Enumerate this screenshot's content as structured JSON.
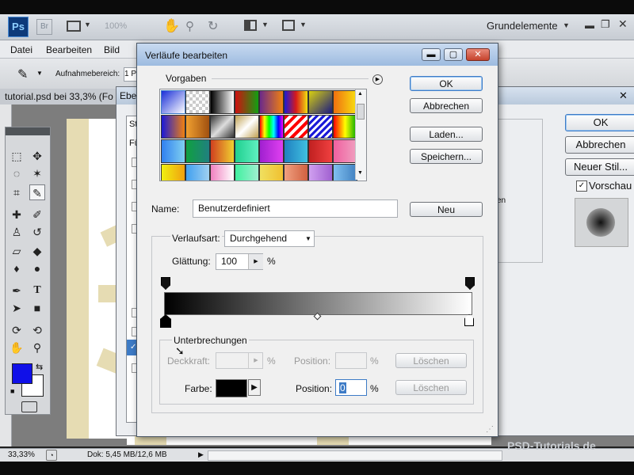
{
  "app": {
    "logo": "Ps",
    "bridge": "Br",
    "zoom_select": "100%",
    "workspace": "Grundelemente",
    "menu": [
      "Datei",
      "Bearbeiten",
      "Bild"
    ],
    "options_label": "Aufnahmebereich:",
    "options_value": "1 P",
    "doc_tab": "tutorial.psd bei 33,3% (Fo",
    "status_zoom": "33,33%",
    "status_doc": "Dok: 5,45 MB/12,6 MB",
    "watermark": "PSD-Tutorials.de"
  },
  "style_dialog": {
    "title_fragment": "Eben",
    "list_items": [
      "St",
      "Fü"
    ],
    "side_text": "en",
    "ok": "OK",
    "cancel": "Abbrechen",
    "new_style": "Neuer Stil...",
    "preview": "Vorschau"
  },
  "dialog": {
    "title": "Verläufe bearbeiten",
    "presets_label": "Vorgaben",
    "buttons": {
      "ok": "OK",
      "cancel": "Abbrechen",
      "load": "Laden...",
      "save": "Speichern...",
      "new": "Neu"
    },
    "name_label": "Name:",
    "name_value": "Benutzerdefiniert",
    "type_label": "Verlaufsart:",
    "type_value": "Durchgehend",
    "smooth_label": "Glättung:",
    "smooth_value": "100",
    "percent": "%",
    "stops": {
      "group_label": "Unterbrechungen",
      "opacity_label": "Deckkraft:",
      "position_label": "Position:",
      "delete": "Löschen",
      "color_label": "Farbe:",
      "color_position_value": "0",
      "color_hex": "#000000"
    }
  },
  "colors": {
    "foreground": "#1010e8",
    "background": "#ffffff",
    "accent": "#3d7bc6"
  }
}
